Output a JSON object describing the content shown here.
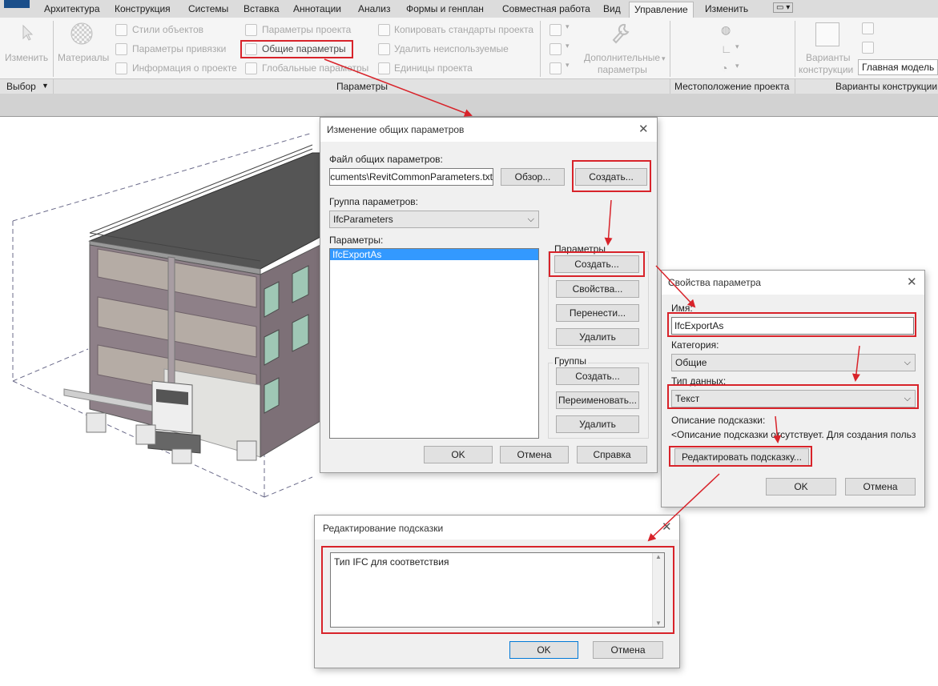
{
  "ribbon": {
    "tabs": [
      "Архитектура",
      "Конструкция",
      "Системы",
      "Вставка",
      "Аннотации",
      "Анализ",
      "Формы и генплан",
      "Совместная работа",
      "Вид",
      "Управление",
      "Изменить"
    ],
    "active_tab": "Управление",
    "modify": "Изменить",
    "materials": "Материалы",
    "object_styles": "Стили объектов",
    "snaps": "Параметры привязки",
    "project_info": "Информация о проекте",
    "project_params": "Параметры проекта",
    "shared_params": "Общие параметры",
    "global_params": "Глобальные  параметры",
    "transfer_standards": "Копировать стандарты проекта",
    "purge_unused": "Удалить неиспользуемые",
    "project_units": "Единицы проекта",
    "additional_settings_1": "Дополнительные",
    "additional_settings_2": "параметры",
    "design_options_1": "Варианты",
    "design_options_2": "конструкции",
    "main_model": "Главная модель",
    "panels": {
      "select": "Выбор",
      "settings": "Параметры",
      "project_location": "Местоположение проекта",
      "design_options": "Варианты конструкции"
    }
  },
  "dialog_shared": {
    "title": "Изменение общих параметров",
    "file_label": "Файл общих параметров:",
    "file_value": "Documents\\RevitCommonParameters.txt",
    "browse": "Обзор...",
    "create_file": "Создать...",
    "group_label": "Группа параметров:",
    "group_value": "IfcParameters",
    "params_label": "Параметры:",
    "params": [
      "IfcExportAs"
    ],
    "params_group": "Параметры",
    "btn_new": "Создать...",
    "btn_props": "Свойства...",
    "btn_move": "Перенести...",
    "btn_delete": "Удалить",
    "groups_group": "Группы",
    "grp_new": "Создать...",
    "grp_rename": "Переименовать...",
    "grp_delete": "Удалить",
    "ok": "OK",
    "cancel": "Отмена",
    "help": "Справка"
  },
  "dialog_props": {
    "title": "Свойства параметра",
    "name_label": "Имя:",
    "name_value": "IfcExportAs",
    "category_label": "Категория:",
    "category_value": "Общие",
    "type_label": "Тип данных:",
    "type_value": "Текст",
    "tooltip_label": "Описание подсказки:",
    "tooltip_value": "<Описание подсказки отсутствует. Для создания польз...",
    "edit_tooltip": "Редактировать подсказку...",
    "ok": "OK",
    "cancel": "Отмена"
  },
  "dialog_tooltip": {
    "title": "Редактирование подсказки",
    "text": "Тип IFC для соответствия",
    "ok": "OK",
    "cancel": "Отмена"
  },
  "colors": {
    "highlight": "#d8232a",
    "arrow": "#d8232a",
    "selection": "#3399ff"
  }
}
